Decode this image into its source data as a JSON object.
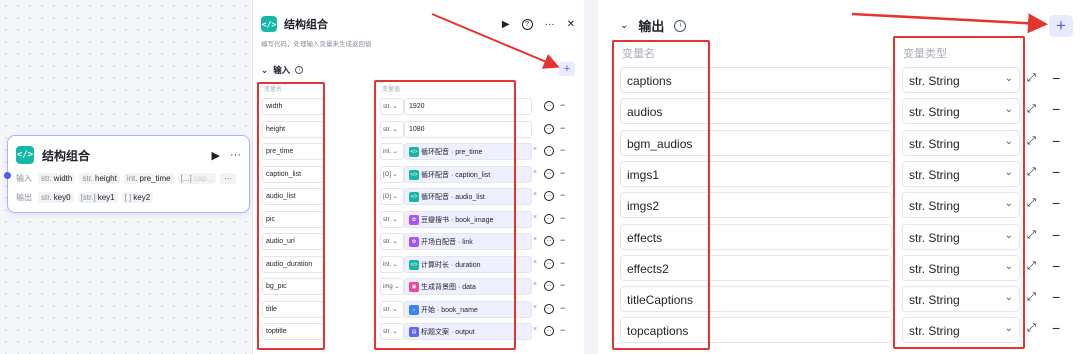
{
  "node": {
    "title": "结构组合",
    "run_icon": "▶",
    "more_icon": "···",
    "input_label": "输入",
    "inputs": [
      {
        "type": "str.",
        "name": "width"
      },
      {
        "type": "str.",
        "name": "height"
      },
      {
        "type": "int.",
        "name": "pre_time"
      },
      {
        "type": "[...]",
        "name": "cap..."
      }
    ],
    "inputs_more": "···",
    "output_label": "输出",
    "outputs": [
      {
        "type": "str.",
        "name": "key0"
      },
      {
        "type": "[str.]",
        "name": "key1"
      },
      {
        "type": "[ ]",
        "name": "key2"
      }
    ]
  },
  "panel": {
    "title": "结构组合",
    "description": "编写代码，处理输入变量来生成返回值",
    "input_section": "输入",
    "col_name": "变量名",
    "col_value": "变量值",
    "inputs": [
      {
        "name": "width",
        "type": "str.",
        "value": "1920",
        "ref": false
      },
      {
        "name": "height",
        "type": "str.",
        "value": "1080",
        "ref": false
      },
      {
        "name": "pre_time",
        "type": "int.",
        "value": "循环配音 · pre_time",
        "ref": true,
        "icon_color": "#14b8a6",
        "icon": "</>"
      },
      {
        "name": "caption_list",
        "type": "[O]",
        "value": "循环配音 · caption_list",
        "ref": true,
        "icon_color": "#14b8a6",
        "icon": "</>"
      },
      {
        "name": "audio_list",
        "type": "[O]",
        "value": "循环配音 · audio_list",
        "ref": true,
        "icon_color": "#14b8a6",
        "icon": "</>"
      },
      {
        "name": "pic",
        "type": "str.",
        "value": "豆瓣搜书 · book_image",
        "ref": true,
        "icon_color": "#a855f7",
        "icon": "✿"
      },
      {
        "name": "audio_url",
        "type": "str.",
        "value": "开场白配音 · link",
        "ref": true,
        "icon_color": "#a855f7",
        "icon": "✿"
      },
      {
        "name": "audio_duration",
        "type": "int.",
        "value": "计算时长 · duration",
        "ref": true,
        "icon_color": "#14b8a6",
        "icon": "</>"
      },
      {
        "name": "bg_pic",
        "type": "img",
        "value": "生成背景图 · data",
        "ref": true,
        "icon_color": "#ec4899",
        "icon": "▣"
      },
      {
        "name": "title",
        "type": "str.",
        "value": "开始 · book_name",
        "ref": true,
        "icon_color": "#3b82f6",
        "icon": "⌂"
      },
      {
        "name": "toptitle",
        "type": "str.",
        "value": "标题文案 · output",
        "ref": true,
        "icon_color": "#6366f1",
        "icon": "▤"
      }
    ]
  },
  "output": {
    "section": "输出",
    "col_name": "变量名",
    "col_type": "变量类型",
    "rows": [
      {
        "name": "captions",
        "type": "str. String"
      },
      {
        "name": "audios",
        "type": "str. String"
      },
      {
        "name": "bgm_audios",
        "type": "str. String"
      },
      {
        "name": "imgs1",
        "type": "str. String"
      },
      {
        "name": "imgs2",
        "type": "str. String"
      },
      {
        "name": "effects",
        "type": "str. String"
      },
      {
        "name": "effects2",
        "type": "str. String"
      },
      {
        "name": "titleCaptions",
        "type": "str. String"
      },
      {
        "name": "topcaptions",
        "type": "str. String"
      }
    ]
  },
  "colors": {
    "accent": "#4e5cf0",
    "highlight_red": "#e5342f",
    "code_icon": "#14b8a6"
  }
}
